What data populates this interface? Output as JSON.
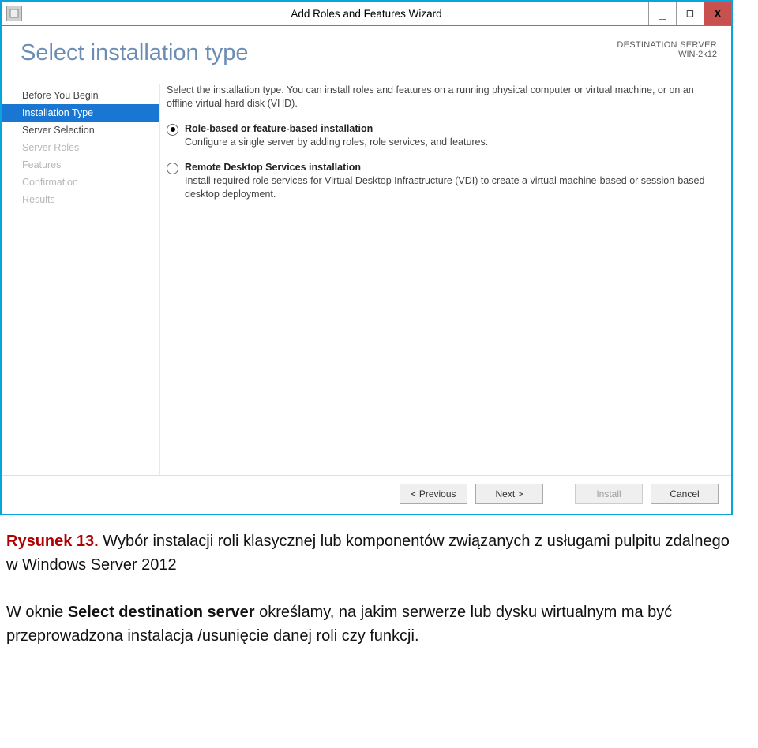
{
  "titlebar": {
    "title": "Add Roles and Features Wizard",
    "min": "_",
    "max": "□",
    "close": "x"
  },
  "header": {
    "title": "Select installation type",
    "dest_label": "DESTINATION SERVER",
    "dest_value": "WIN-2k12"
  },
  "nav": {
    "items": [
      {
        "label": "Before You Begin",
        "state": "enabled"
      },
      {
        "label": "Installation Type",
        "state": "selected"
      },
      {
        "label": "Server Selection",
        "state": "enabled"
      },
      {
        "label": "Server Roles",
        "state": "disabled"
      },
      {
        "label": "Features",
        "state": "disabled"
      },
      {
        "label": "Confirmation",
        "state": "disabled"
      },
      {
        "label": "Results",
        "state": "disabled"
      }
    ]
  },
  "main": {
    "intro": "Select the installation type. You can install roles and features on a running physical computer or virtual machine, or on an offline virtual hard disk (VHD).",
    "options": [
      {
        "checked": true,
        "title": "Role-based or feature-based installation",
        "desc": "Configure a single server by adding roles, role services, and features."
      },
      {
        "checked": false,
        "title": "Remote Desktop Services installation",
        "desc": "Install required role services for Virtual Desktop Infrastructure (VDI) to create a virtual machine-based or session-based desktop deployment."
      }
    ]
  },
  "footer": {
    "prev": "< Previous",
    "next": "Next >",
    "install": "Install",
    "cancel": "Cancel"
  },
  "caption": {
    "fig_label": "Rysunek 13.",
    "fig_text": " Wybór instalacji roli klasycznej lub komponentów związanych z usługami pulpitu zdalnego w Windows Server 2012",
    "para1_a": "W oknie ",
    "para1_b": "Select destination server",
    "para1_c": " określamy, na jakim serwerze lub dysku wirtualnym ma być przeprowadzona instalacja /usunięcie danej roli czy funkcji."
  }
}
